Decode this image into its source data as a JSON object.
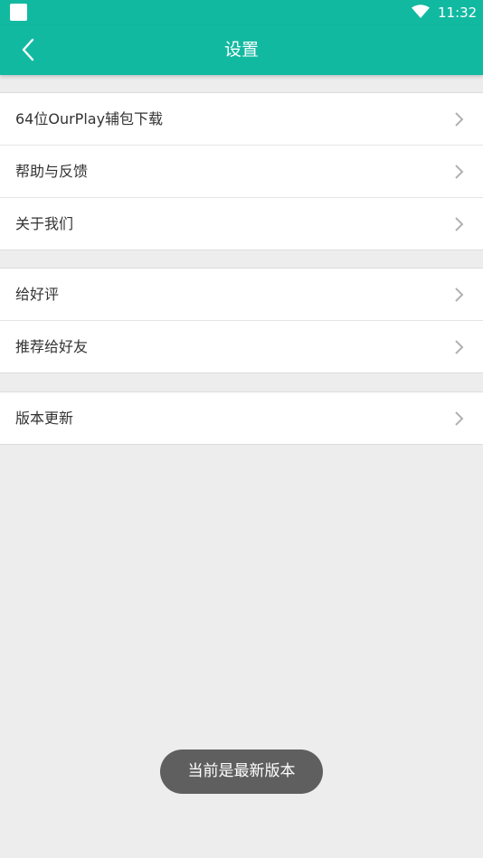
{
  "status_bar": {
    "time": "11:32"
  },
  "header": {
    "title": "设置"
  },
  "groups": [
    {
      "items": [
        {
          "label": "64位OurPlay辅包下载"
        },
        {
          "label": "帮助与反馈"
        },
        {
          "label": "关于我们"
        }
      ]
    },
    {
      "items": [
        {
          "label": "给好评"
        },
        {
          "label": "推荐给好友"
        }
      ]
    },
    {
      "items": [
        {
          "label": "版本更新"
        }
      ]
    }
  ],
  "toast": {
    "message": "当前是最新版本"
  },
  "colors": {
    "accent": "#12b9a1",
    "background": "#ededed",
    "toast": "#5f5f5f"
  }
}
